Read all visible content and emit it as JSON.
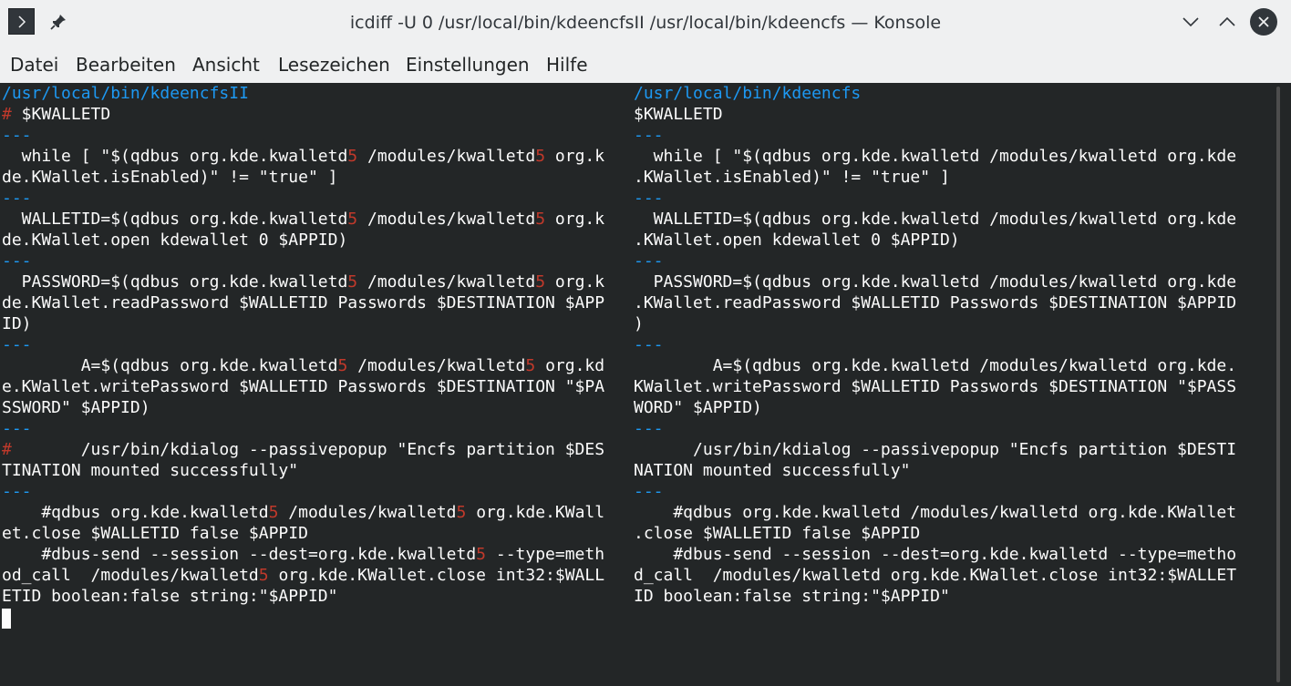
{
  "window": {
    "title": "icdiff -U 0 /usr/local/bin/kdeencfsII /usr/local/bin/kdeencfs — Konsole"
  },
  "menubar": [
    "Datei",
    "Bearbeiten",
    "Ansicht",
    "Lesezeichen",
    "Einstellungen",
    "Hilfe"
  ],
  "colors": {
    "path": "#1d99f3",
    "separator": "#1d99f3",
    "changed": "#c0392b",
    "text": "#fcfcfc",
    "background": "#232627"
  },
  "icons": {
    "menu": "chevron-right-icon",
    "pin": "pin-icon",
    "minimize": "chevron-down-icon",
    "maximize": "chevron-up-icon",
    "close": "close-icon"
  },
  "left_pane": [
    [
      {
        "t": "/usr/local/bin/kdeencfsII",
        "s": "path"
      }
    ],
    [
      {
        "t": "#",
        "s": "red"
      },
      {
        "t": " $KWALLETD",
        "s": "normal"
      }
    ],
    [
      {
        "t": "---",
        "s": "sep"
      }
    ],
    [
      {
        "t": "  while [ \"$(qdbus org.kde.kwalletd",
        "s": "normal"
      },
      {
        "t": "5",
        "s": "red"
      },
      {
        "t": " /modules/kwalletd",
        "s": "normal"
      },
      {
        "t": "5",
        "s": "red"
      },
      {
        "t": " org.k",
        "s": "normal"
      }
    ],
    [
      {
        "t": "de.KWallet.isEnabled)\" != \"true\" ]",
        "s": "normal"
      }
    ],
    [
      {
        "t": "---",
        "s": "sep"
      }
    ],
    [
      {
        "t": "  WALLETID=$(qdbus org.kde.kwalletd",
        "s": "normal"
      },
      {
        "t": "5",
        "s": "red"
      },
      {
        "t": " /modules/kwalletd",
        "s": "normal"
      },
      {
        "t": "5",
        "s": "red"
      },
      {
        "t": " org.k",
        "s": "normal"
      }
    ],
    [
      {
        "t": "de.KWallet.open kdewallet 0 $APPID)",
        "s": "normal"
      }
    ],
    [
      {
        "t": "---",
        "s": "sep"
      }
    ],
    [
      {
        "t": "  PASSWORD=$(qdbus org.kde.kwalletd",
        "s": "normal"
      },
      {
        "t": "5",
        "s": "red"
      },
      {
        "t": " /modules/kwalletd",
        "s": "normal"
      },
      {
        "t": "5",
        "s": "red"
      },
      {
        "t": " org.k",
        "s": "normal"
      }
    ],
    [
      {
        "t": "de.KWallet.readPassword $WALLETID Passwords $DESTINATION $APP",
        "s": "normal"
      }
    ],
    [
      {
        "t": "ID)",
        "s": "normal"
      }
    ],
    [
      {
        "t": "---",
        "s": "sep"
      }
    ],
    [
      {
        "t": "        A=$(qdbus org.kde.kwalletd",
        "s": "normal"
      },
      {
        "t": "5",
        "s": "red"
      },
      {
        "t": " /modules/kwalletd",
        "s": "normal"
      },
      {
        "t": "5",
        "s": "red"
      },
      {
        "t": " org.kd",
        "s": "normal"
      }
    ],
    [
      {
        "t": "e.KWallet.writePassword $WALLETID Passwords $DESTINATION \"$PA",
        "s": "normal"
      }
    ],
    [
      {
        "t": "SSWORD\" $APPID)",
        "s": "normal"
      }
    ],
    [
      {
        "t": "---",
        "s": "sep"
      }
    ],
    [
      {
        "t": "#",
        "s": "red"
      },
      {
        "t": "       /usr/bin/kdialog --passivepopup \"Encfs partition $DES",
        "s": "normal"
      }
    ],
    [
      {
        "t": "TINATION mounted successfully\"",
        "s": "normal"
      }
    ],
    [
      {
        "t": "---",
        "s": "sep"
      }
    ],
    [
      {
        "t": "    #qdbus org.kde.kwalletd",
        "s": "normal"
      },
      {
        "t": "5",
        "s": "red"
      },
      {
        "t": " /modules/kwalletd",
        "s": "normal"
      },
      {
        "t": "5",
        "s": "red"
      },
      {
        "t": " org.kde.KWall",
        "s": "normal"
      }
    ],
    [
      {
        "t": "et.close $WALLETID false $APPID",
        "s": "normal"
      }
    ],
    [
      {
        "t": "    #dbus-send --session --dest=org.kde.kwalletd",
        "s": "normal"
      },
      {
        "t": "5",
        "s": "red"
      },
      {
        "t": " --type=meth",
        "s": "normal"
      }
    ],
    [
      {
        "t": "od_call  /modules/kwalletd",
        "s": "normal"
      },
      {
        "t": "5",
        "s": "red"
      },
      {
        "t": " org.kde.KWallet.close int32:$WALL",
        "s": "normal"
      }
    ],
    [
      {
        "t": "ETID boolean:false string:\"$APPID\"",
        "s": "normal"
      }
    ]
  ],
  "right_pane": [
    [
      {
        "t": "/usr/local/bin/kdeencfs",
        "s": "path"
      }
    ],
    [
      {
        "t": "$KWALLETD",
        "s": "normal"
      }
    ],
    [
      {
        "t": "---",
        "s": "sep"
      }
    ],
    [
      {
        "t": "  while [ \"$(qdbus org.kde.kwalletd /modules/kwalletd org.kde",
        "s": "normal"
      }
    ],
    [
      {
        "t": ".KWallet.isEnabled)\" != \"true\" ]",
        "s": "normal"
      }
    ],
    [
      {
        "t": "---",
        "s": "sep"
      }
    ],
    [
      {
        "t": "  WALLETID=$(qdbus org.kde.kwalletd /modules/kwalletd org.kde",
        "s": "normal"
      }
    ],
    [
      {
        "t": ".KWallet.open kdewallet 0 $APPID)",
        "s": "normal"
      }
    ],
    [
      {
        "t": "---",
        "s": "sep"
      }
    ],
    [
      {
        "t": "  PASSWORD=$(qdbus org.kde.kwalletd /modules/kwalletd org.kde",
        "s": "normal"
      }
    ],
    [
      {
        "t": ".KWallet.readPassword $WALLETID Passwords $DESTINATION $APPID",
        "s": "normal"
      }
    ],
    [
      {
        "t": ")",
        "s": "normal"
      }
    ],
    [
      {
        "t": "---",
        "s": "sep"
      }
    ],
    [
      {
        "t": "        A=$(qdbus org.kde.kwalletd /modules/kwalletd org.kde.",
        "s": "normal"
      }
    ],
    [
      {
        "t": "KWallet.writePassword $WALLETID Passwords $DESTINATION \"$PASS",
        "s": "normal"
      }
    ],
    [
      {
        "t": "WORD\" $APPID)",
        "s": "normal"
      }
    ],
    [
      {
        "t": "---",
        "s": "sep"
      }
    ],
    [
      {
        "t": "      /usr/bin/kdialog --passivepopup \"Encfs partition $DESTI",
        "s": "normal"
      }
    ],
    [
      {
        "t": "NATION mounted successfully\"",
        "s": "normal"
      }
    ],
    [
      {
        "t": "---",
        "s": "sep"
      }
    ],
    [
      {
        "t": "    #qdbus org.kde.kwalletd /modules/kwalletd org.kde.KWallet",
        "s": "normal"
      }
    ],
    [
      {
        "t": ".close $WALLETID false $APPID",
        "s": "normal"
      }
    ],
    [
      {
        "t": "    #dbus-send --session --dest=org.kde.kwalletd --type=metho",
        "s": "normal"
      }
    ],
    [
      {
        "t": "d_call  /modules/kwalletd org.kde.KWallet.close int32:$WALLET",
        "s": "normal"
      }
    ],
    [
      {
        "t": "ID boolean:false string:\"$APPID\"",
        "s": "normal"
      }
    ]
  ]
}
